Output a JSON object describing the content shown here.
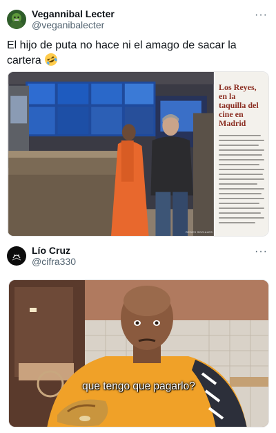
{
  "tweet1": {
    "display_name": "Vegannibal Lecter",
    "handle": "@veganibalecter",
    "text": "El hijo de puta no hace ni el amago de sacar la cartera",
    "emoji": "rolling-on-floor-laughing",
    "more": "···",
    "image": {
      "headline": "Los Reyes, en la taquilla del cine en Madrid",
      "credit": "REDES SOCIALES"
    }
  },
  "tweet2": {
    "display_name": "Lío Cruz",
    "handle": "@cifra330",
    "more": "···",
    "image": {
      "caption": "que tengo que pagarlo?"
    }
  }
}
